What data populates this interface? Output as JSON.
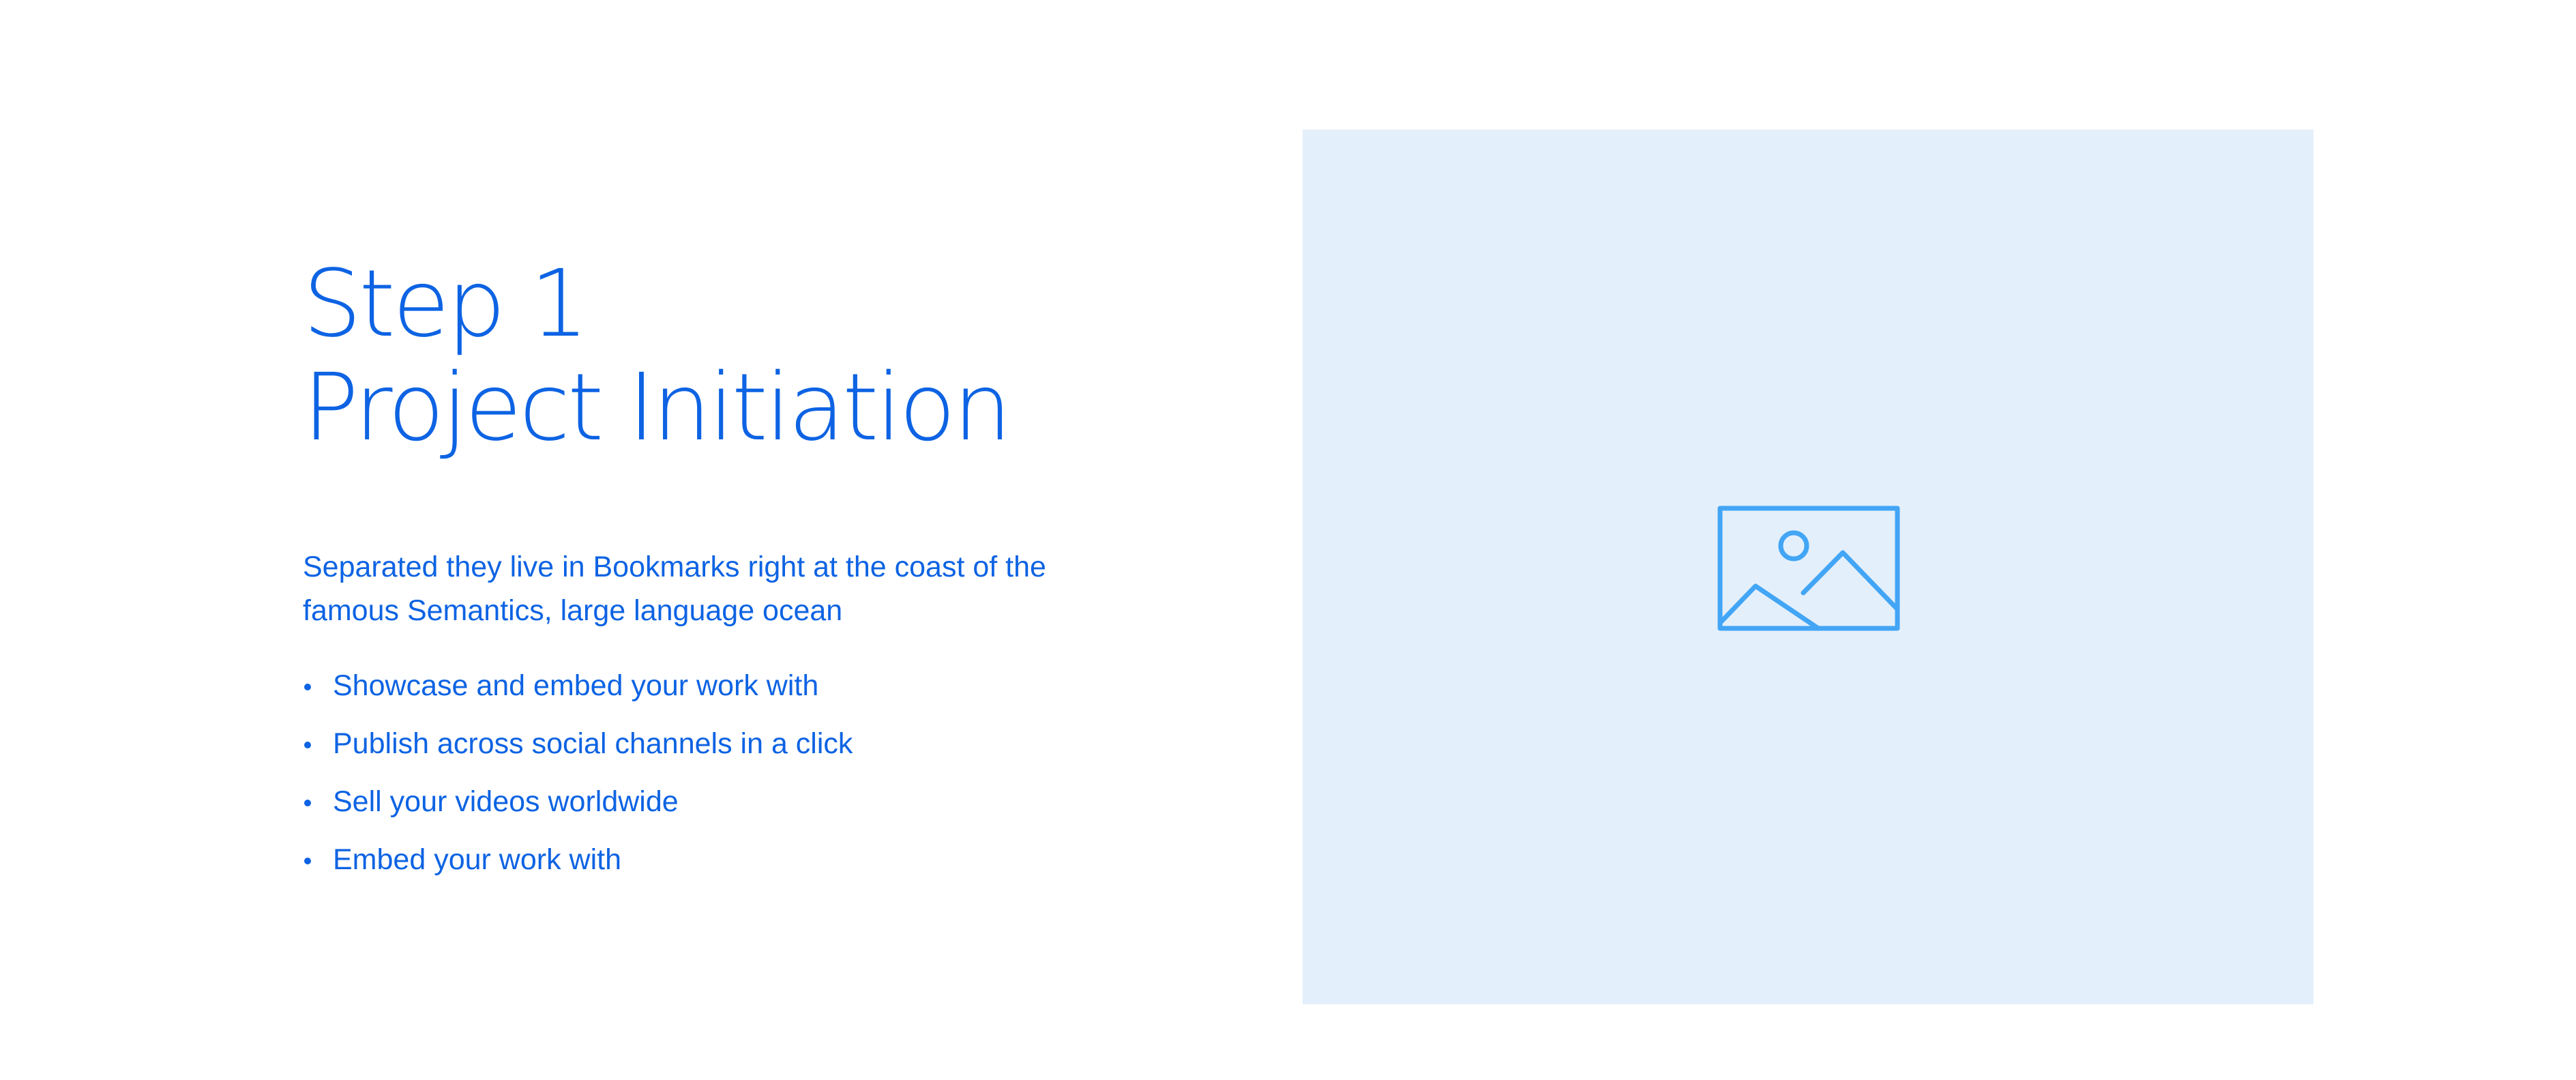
{
  "step": {
    "title_line1": "Step 1",
    "title_line2": "Project Initiation",
    "description": "Separated they live in Bookmarks right at the coast of the famous Semantics, large language ocean",
    "bullets": [
      "Showcase and embed your work with",
      "Publish across social channels in a click",
      "Sell your videos worldwide",
      "Embed your work with"
    ]
  },
  "image": {
    "icon": "image-placeholder-icon"
  },
  "colors": {
    "text_primary": "#0d63e3",
    "placeholder_bg": "#e3effb",
    "icon_stroke": "#42a5f5"
  }
}
